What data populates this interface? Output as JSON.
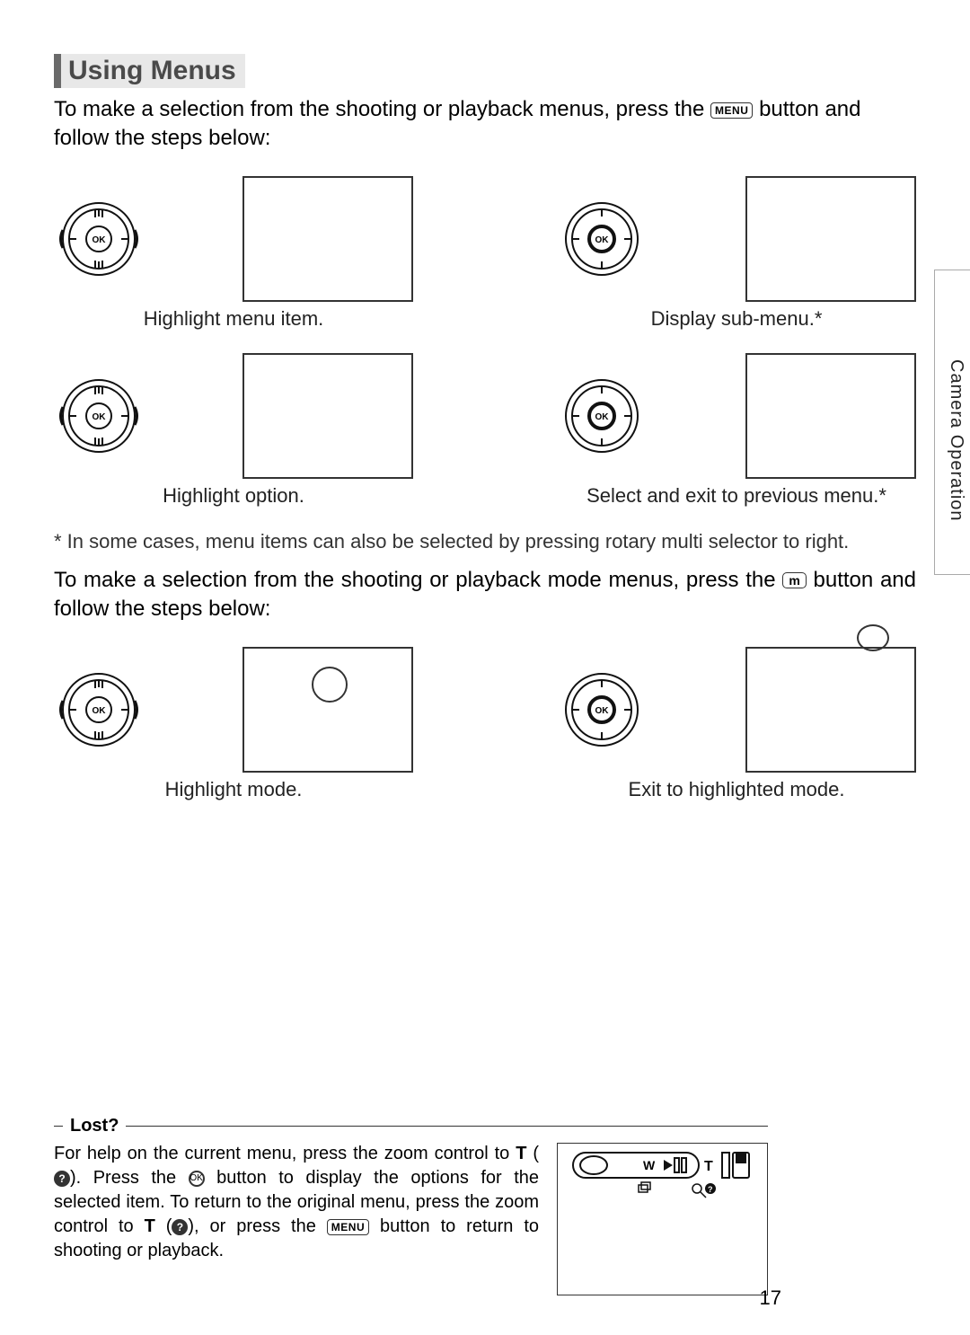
{
  "heading": "Using Menus",
  "intro_before": "To make a selection from the shooting or playback menus, press the ",
  "intro_menu_label": "MENU",
  "intro_after": " button and follow the steps below:",
  "steps1": {
    "a": "Highlight menu item.",
    "b": "Display sub-menu.*",
    "c": "Highlight option.",
    "d": "Select and exit to previous menu.*"
  },
  "footnote": "* In some cases, menu items can also be selected by pressing rotary multi selector to right.",
  "intro2_before": "To make a selection from the shooting or playback mode menus, press the ",
  "intro2_mode_label": "m",
  "intro2_after": " button and follow the steps below:",
  "steps2": {
    "a": "Highlight mode.",
    "b": "Exit to highlighted mode."
  },
  "section_label": "Camera Operation",
  "lost": {
    "title": "Lost?",
    "text_1": "For help on the current menu, press the zoom control to ",
    "T": "T",
    "text_2": ". Press the ",
    "text_3": " button to display the options for the selected item. To return to the original menu, press the zoom control to ",
    "text_4": ", or press the ",
    "text_5": " button to return to shooting or playback."
  },
  "ok_label": "OK",
  "zoom_W": "W",
  "zoom_T": "T",
  "page_number": "17"
}
